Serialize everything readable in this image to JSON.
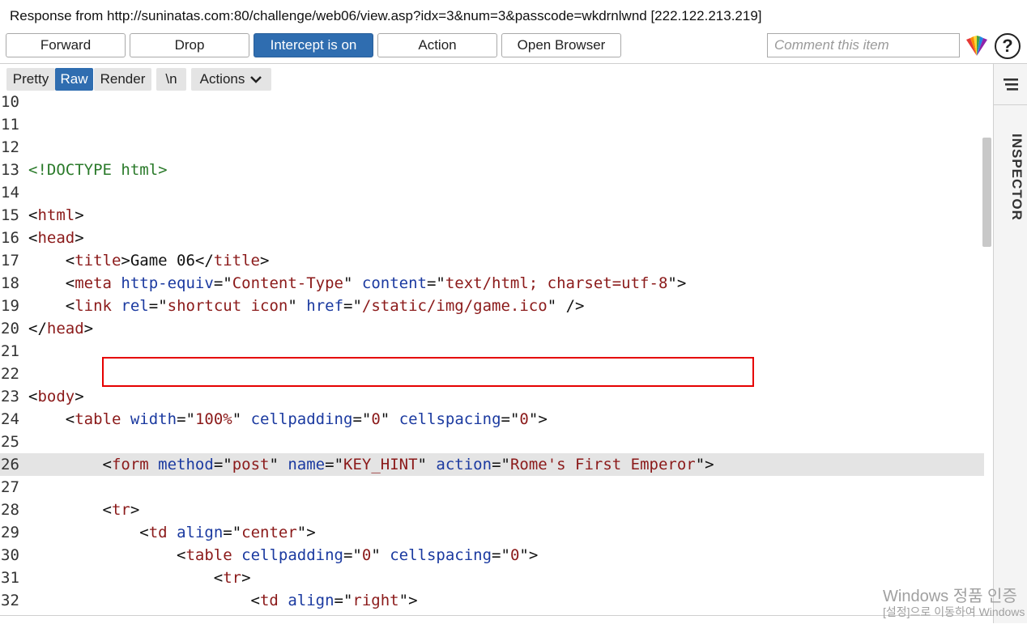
{
  "window": {
    "title": "Response from http://suninatas.com:80/challenge/web06/view.asp?idx=3&num=3&passcode=wkdrnlwnd  [222.122.213.219]"
  },
  "toolbar": {
    "forward_label": "Forward",
    "drop_label": "Drop",
    "intercept_label": "Intercept is on",
    "action_label": "Action",
    "open_browser_label": "Open Browser",
    "comment_placeholder": "Comment this item",
    "help_label": "?"
  },
  "viewbar": {
    "pretty_label": "Pretty",
    "raw_label": "Raw",
    "render_label": "Render",
    "newline_label": "\\n",
    "actions_label": "Actions"
  },
  "side_panel": {
    "inspector_label": "INSPECTOR"
  },
  "editor": {
    "current_line": 26,
    "lines": [
      {
        "n": "10",
        "segments": []
      },
      {
        "n": "11",
        "segments": []
      },
      {
        "n": "12",
        "segments": []
      },
      {
        "n": "13",
        "segments": [
          {
            "t": "doc",
            "v": "<!DOCTYPE html>"
          }
        ]
      },
      {
        "n": "14",
        "segments": []
      },
      {
        "n": "15",
        "segments": [
          {
            "t": "code",
            "v": "<"
          },
          {
            "t": "tag",
            "v": "html"
          },
          {
            "t": "code",
            "v": ">"
          }
        ]
      },
      {
        "n": "16",
        "segments": [
          {
            "t": "code",
            "v": "<"
          },
          {
            "t": "tag",
            "v": "head"
          },
          {
            "t": "code",
            "v": ">"
          }
        ]
      },
      {
        "n": "17",
        "segments": [
          {
            "t": "code",
            "v": "    <"
          },
          {
            "t": "tag",
            "v": "title"
          },
          {
            "t": "code",
            "v": ">Game 06</"
          },
          {
            "t": "tag",
            "v": "title"
          },
          {
            "t": "code",
            "v": ">"
          }
        ]
      },
      {
        "n": "18",
        "segments": [
          {
            "t": "code",
            "v": "    <"
          },
          {
            "t": "tag",
            "v": "meta"
          },
          {
            "t": "code",
            "v": " "
          },
          {
            "t": "attr",
            "v": "http-equiv"
          },
          {
            "t": "code",
            "v": "=\""
          },
          {
            "t": "val",
            "v": "Content-Type"
          },
          {
            "t": "code",
            "v": "\" "
          },
          {
            "t": "attr",
            "v": "content"
          },
          {
            "t": "code",
            "v": "=\""
          },
          {
            "t": "val",
            "v": "text/html; charset=utf-8"
          },
          {
            "t": "code",
            "v": "\">"
          }
        ]
      },
      {
        "n": "19",
        "segments": [
          {
            "t": "code",
            "v": "    <"
          },
          {
            "t": "tag",
            "v": "link"
          },
          {
            "t": "code",
            "v": " "
          },
          {
            "t": "attr",
            "v": "rel"
          },
          {
            "t": "code",
            "v": "=\""
          },
          {
            "t": "val",
            "v": "shortcut icon"
          },
          {
            "t": "code",
            "v": "\" "
          },
          {
            "t": "attr",
            "v": "href"
          },
          {
            "t": "code",
            "v": "=\""
          },
          {
            "t": "val",
            "v": "/static/img/game.ico"
          },
          {
            "t": "code",
            "v": "\" />"
          }
        ]
      },
      {
        "n": "20",
        "segments": [
          {
            "t": "code",
            "v": "</"
          },
          {
            "t": "tag",
            "v": "head"
          },
          {
            "t": "code",
            "v": ">"
          }
        ]
      },
      {
        "n": "21",
        "segments": []
      },
      {
        "n": "22",
        "segments": []
      },
      {
        "n": "23",
        "segments": [
          {
            "t": "code",
            "v": "<"
          },
          {
            "t": "tag",
            "v": "body"
          },
          {
            "t": "code",
            "v": ">"
          }
        ]
      },
      {
        "n": "24",
        "segments": [
          {
            "t": "code",
            "v": "    <"
          },
          {
            "t": "tag",
            "v": "table"
          },
          {
            "t": "code",
            "v": " "
          },
          {
            "t": "attr",
            "v": "width"
          },
          {
            "t": "code",
            "v": "=\""
          },
          {
            "t": "val",
            "v": "100%"
          },
          {
            "t": "code",
            "v": "\" "
          },
          {
            "t": "attr",
            "v": "cellpadding"
          },
          {
            "t": "code",
            "v": "=\""
          },
          {
            "t": "val",
            "v": "0"
          },
          {
            "t": "code",
            "v": "\" "
          },
          {
            "t": "attr",
            "v": "cellspacing"
          },
          {
            "t": "code",
            "v": "=\""
          },
          {
            "t": "val",
            "v": "0"
          },
          {
            "t": "code",
            "v": "\">"
          }
        ]
      },
      {
        "n": "25",
        "segments": []
      },
      {
        "n": "26",
        "segments": [
          {
            "t": "code",
            "v": "        <"
          },
          {
            "t": "tag",
            "v": "form"
          },
          {
            "t": "code",
            "v": " "
          },
          {
            "t": "attr",
            "v": "method"
          },
          {
            "t": "code",
            "v": "=\""
          },
          {
            "t": "val",
            "v": "post"
          },
          {
            "t": "code",
            "v": "\" "
          },
          {
            "t": "attr",
            "v": "name"
          },
          {
            "t": "code",
            "v": "=\""
          },
          {
            "t": "val",
            "v": "KEY_HINT"
          },
          {
            "t": "code",
            "v": "\" "
          },
          {
            "t": "attr",
            "v": "action"
          },
          {
            "t": "code",
            "v": "=\""
          },
          {
            "t": "val",
            "v": "Rome's First Emperor"
          },
          {
            "t": "code",
            "v": "\">"
          }
        ]
      },
      {
        "n": "27",
        "segments": []
      },
      {
        "n": "28",
        "segments": [
          {
            "t": "code",
            "v": "        <"
          },
          {
            "t": "tag",
            "v": "tr"
          },
          {
            "t": "code",
            "v": ">"
          }
        ]
      },
      {
        "n": "29",
        "segments": [
          {
            "t": "code",
            "v": "            <"
          },
          {
            "t": "tag",
            "v": "td"
          },
          {
            "t": "code",
            "v": " "
          },
          {
            "t": "attr",
            "v": "align"
          },
          {
            "t": "code",
            "v": "=\""
          },
          {
            "t": "val",
            "v": "center"
          },
          {
            "t": "code",
            "v": "\">"
          }
        ]
      },
      {
        "n": "30",
        "segments": [
          {
            "t": "code",
            "v": "                <"
          },
          {
            "t": "tag",
            "v": "table"
          },
          {
            "t": "code",
            "v": " "
          },
          {
            "t": "attr",
            "v": "cellpadding"
          },
          {
            "t": "code",
            "v": "=\""
          },
          {
            "t": "val",
            "v": "0"
          },
          {
            "t": "code",
            "v": "\" "
          },
          {
            "t": "attr",
            "v": "cellspacing"
          },
          {
            "t": "code",
            "v": "=\""
          },
          {
            "t": "val",
            "v": "0"
          },
          {
            "t": "code",
            "v": "\">"
          }
        ]
      },
      {
        "n": "31",
        "segments": [
          {
            "t": "code",
            "v": "                    <"
          },
          {
            "t": "tag",
            "v": "tr"
          },
          {
            "t": "code",
            "v": ">"
          }
        ]
      },
      {
        "n": "32",
        "segments": [
          {
            "t": "code",
            "v": "                        <"
          },
          {
            "t": "tag",
            "v": "td"
          },
          {
            "t": "code",
            "v": " "
          },
          {
            "t": "attr",
            "v": "align"
          },
          {
            "t": "code",
            "v": "=\""
          },
          {
            "t": "val",
            "v": "right"
          },
          {
            "t": "code",
            "v": "\">"
          }
        ]
      }
    ]
  },
  "watermark": {
    "line1": "Windows 정품 인증",
    "line2": "[설정]으로 이동하여 Windows"
  },
  "colors": {
    "accent": "#2f6db0",
    "highlight_border": "#e60000",
    "tag": "#8b1a1a",
    "attr": "#1b3aa0",
    "doctype": "#2a7a2a"
  }
}
